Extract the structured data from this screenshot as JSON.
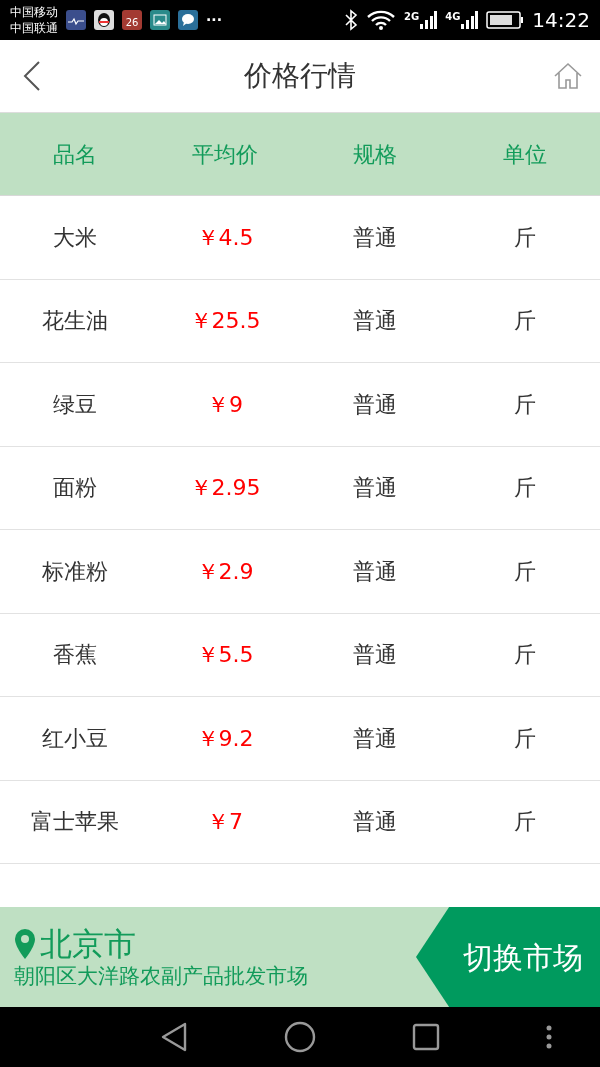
{
  "status_bar": {
    "carriers": [
      "中国移动",
      "中国联通"
    ],
    "calendar_day": "26",
    "more": "···",
    "network_1": "2G",
    "network_2": "4G",
    "time": "14:22"
  },
  "header": {
    "title": "价格行情"
  },
  "table": {
    "columns": [
      "品名",
      "平均价",
      "规格",
      "单位"
    ],
    "rows": [
      {
        "name": "大米",
        "price": "￥4.5",
        "spec": "普通",
        "unit": "斤"
      },
      {
        "name": "花生油",
        "price": "￥25.5",
        "spec": "普通",
        "unit": "斤"
      },
      {
        "name": "绿豆",
        "price": "￥9",
        "spec": "普通",
        "unit": "斤"
      },
      {
        "name": "面粉",
        "price": "￥2.95",
        "spec": "普通",
        "unit": "斤"
      },
      {
        "name": "标准粉",
        "price": "￥2.9",
        "spec": "普通",
        "unit": "斤"
      },
      {
        "name": "香蕉",
        "price": "￥5.5",
        "spec": "普通",
        "unit": "斤"
      },
      {
        "name": "红小豆",
        "price": "￥9.2",
        "spec": "普通",
        "unit": "斤"
      },
      {
        "name": "富士苹果",
        "price": "￥7",
        "spec": "普通",
        "unit": "斤"
      }
    ]
  },
  "market": {
    "city": "北京市",
    "address": "朝阳区大洋路农副产品批发市场",
    "switch_button": "切换市场"
  }
}
